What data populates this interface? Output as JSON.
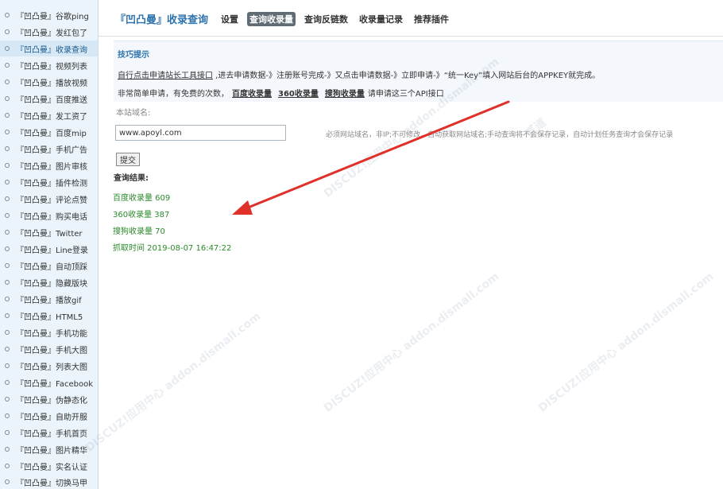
{
  "sidebar": {
    "items": [
      {
        "label": "『凹凸曼』谷歌ping",
        "active": false
      },
      {
        "label": "『凹凸曼』发红包了",
        "active": false
      },
      {
        "label": "『凹凸曼』收录查询",
        "active": true
      },
      {
        "label": "『凹凸曼』视频列表",
        "active": false
      },
      {
        "label": "『凹凸曼』播放视频",
        "active": false
      },
      {
        "label": "『凹凸曼』百度推送",
        "active": false
      },
      {
        "label": "『凹凸曼』发工资了",
        "active": false
      },
      {
        "label": "『凹凸曼』百度mip",
        "active": false
      },
      {
        "label": "『凹凸曼』手机广告",
        "active": false
      },
      {
        "label": "『凹凸曼』图片审核",
        "active": false
      },
      {
        "label": "『凹凸曼』插件检测",
        "active": false
      },
      {
        "label": "『凹凸曼』评论点赞",
        "active": false
      },
      {
        "label": "『凹凸曼』购买电话",
        "active": false
      },
      {
        "label": "『凹凸曼』Twitter",
        "active": false
      },
      {
        "label": "『凹凸曼』Line登录",
        "active": false
      },
      {
        "label": "『凹凸曼』自动顶踩",
        "active": false
      },
      {
        "label": "『凹凸曼』隐藏版块",
        "active": false
      },
      {
        "label": "『凹凸曼』播放gif",
        "active": false
      },
      {
        "label": "『凹凸曼』HTML5",
        "active": false
      },
      {
        "label": "『凹凸曼』手机功能",
        "active": false
      },
      {
        "label": "『凹凸曼』手机大图",
        "active": false
      },
      {
        "label": "『凹凸曼』列表大图",
        "active": false
      },
      {
        "label": "『凹凸曼』Facebook",
        "active": false
      },
      {
        "label": "『凹凸曼』伪静态化",
        "active": false
      },
      {
        "label": "『凹凸曼』自助开服",
        "active": false
      },
      {
        "label": "『凹凸曼』手机首页",
        "active": false
      },
      {
        "label": "『凹凸曼』图片精华",
        "active": false
      },
      {
        "label": "『凹凸曼』实名认证",
        "active": false
      },
      {
        "label": "『凹凸曼』切换马甲",
        "active": false
      }
    ]
  },
  "header": {
    "brand": "『凹凸曼』收录查询",
    "nav": [
      {
        "label": "设置",
        "active": false
      },
      {
        "label": "查询收录量",
        "active": true
      },
      {
        "label": "查询反链数",
        "active": false
      },
      {
        "label": "收录量记录",
        "active": false
      },
      {
        "label": "推荐插件",
        "active": false
      }
    ]
  },
  "tips": {
    "title": "技巧提示",
    "line1_link": "自行点击申请站长工具接口",
    "line1_rest": " ,进去申请数据-》注册账号完成-》又点击申请数据-》立即申请-》“统一Key”填入网站后台的APPKEY就完成。",
    "line2_prefix": "非常简单申请，有免费的次数，",
    "line2_links": [
      "百度收录量",
      "360收录量",
      "搜狗收录量"
    ],
    "line2_suffix": "请申请这三个API接口"
  },
  "form": {
    "label": "本站域名:",
    "domain_value": "www.apoyl.com",
    "hint": "必须网站域名，非IP;不可修改，自动获取网站域名;手动查询将不会保存记录，自动计划任务查询才会保存记录",
    "submit_label": "提交"
  },
  "results": {
    "title": "查询结果:",
    "items": [
      "百度收录量 609",
      "360收录量 387",
      "搜狗收录量 70",
      "抓取时间 2019-08-07 16:47:22"
    ]
  },
  "watermark": {
    "brand": "DISCUZ!应用中心",
    "url": "addon.dismall.com",
    "mark": "贰道"
  },
  "colors": {
    "accent": "#2d73ad",
    "result_green": "#2a8a2a",
    "arrow_red": "#e0302a",
    "sidebar_bg": "#ebf4fb"
  }
}
